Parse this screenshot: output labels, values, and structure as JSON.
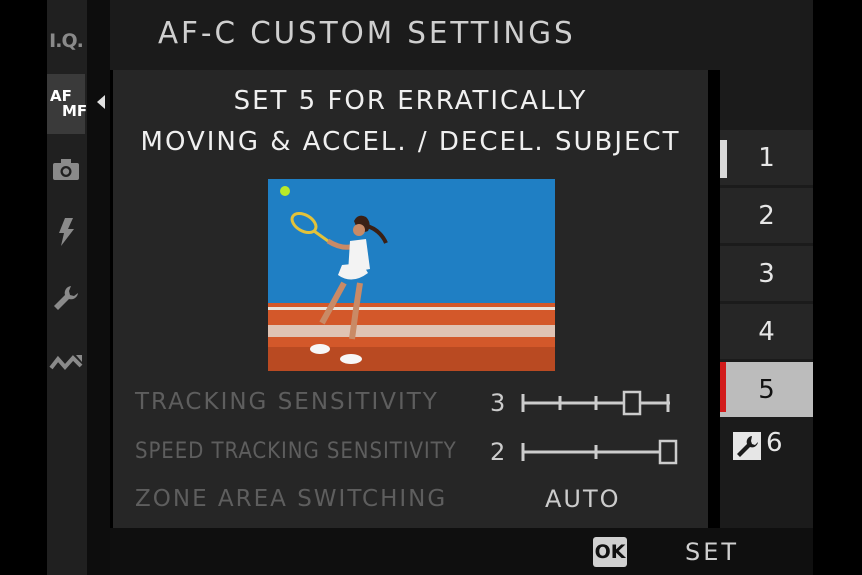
{
  "header": {
    "title": "AF-C CUSTOM SETTINGS"
  },
  "rail": {
    "items": [
      {
        "label": "I.Q.",
        "icon": "image-quality-icon"
      },
      {
        "label_line1": "AF",
        "label_line2": "MF",
        "icon": "af-mf-icon",
        "active": true
      },
      {
        "icon": "camera-icon"
      },
      {
        "icon": "flash-icon"
      },
      {
        "icon": "wrench-icon"
      },
      {
        "icon": "my-menu-icon"
      }
    ]
  },
  "panel": {
    "description_line1": "SET 5 FOR ERRATICALLY",
    "description_line2": "MOVING & ACCEL. / DECEL. SUBJECT",
    "settings": {
      "tracking": {
        "label": "TRACKING SENSITIVITY",
        "value": "3",
        "level": 3,
        "max": 4
      },
      "speed": {
        "label": "SPEED TRACKING SENSITIVITY",
        "value": "2",
        "level": 2,
        "max": 2
      },
      "zone": {
        "label": "ZONE AREA SWITCHING",
        "value": "AUTO"
      }
    }
  },
  "sets": {
    "items": [
      "1",
      "2",
      "3",
      "4",
      "5",
      "6"
    ],
    "selected": "5",
    "custom_icon": "wrench-icon"
  },
  "footer": {
    "ok_label": "OK",
    "set_label": "SET"
  },
  "colors": {
    "accent": "#d21a1a",
    "selected_bg": "#bcbcbc",
    "panel_bg": "#262626",
    "court_blue": "#1f7fc4",
    "court_clay": "#d3582a"
  }
}
